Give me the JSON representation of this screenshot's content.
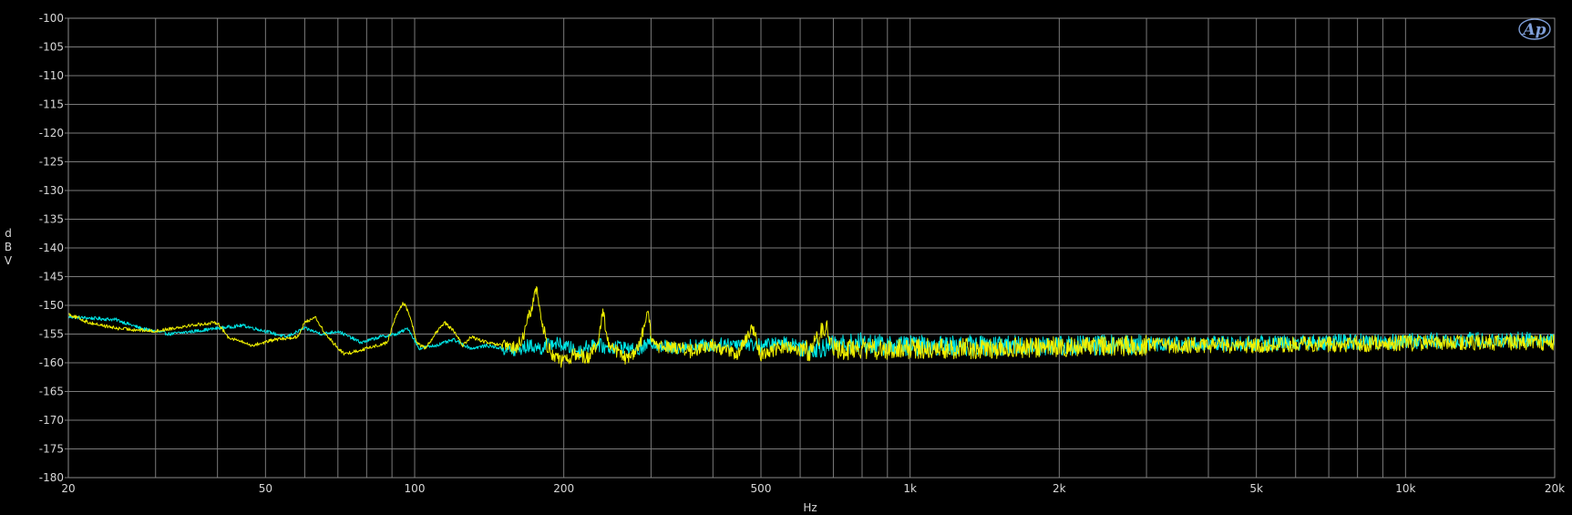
{
  "logo_text": "Ap",
  "chart_data": {
    "type": "line",
    "title": "",
    "xlabel": "Hz",
    "ylabel": "dBV",
    "xscale": "log",
    "xlim": [
      20,
      20000
    ],
    "ylim": [
      -180,
      -100
    ],
    "grid": true,
    "x_major_ticks": [
      20,
      50,
      100,
      200,
      500,
      1000,
      2000,
      5000,
      10000,
      20000
    ],
    "x_tick_labels": [
      "20",
      "50",
      "100",
      "200",
      "500",
      "1k",
      "2k",
      "5k",
      "10k",
      "20k"
    ],
    "x_minor_gridlines": [
      30,
      40,
      60,
      70,
      80,
      90,
      300,
      400,
      600,
      700,
      800,
      900,
      3000,
      4000,
      6000,
      7000,
      8000,
      9000
    ],
    "y_ticks": [
      -100,
      -105,
      -110,
      -115,
      -120,
      -125,
      -130,
      -135,
      -140,
      -145,
      -150,
      -155,
      -160,
      -165,
      -170,
      -175,
      -180
    ],
    "colors": {
      "background": "#000000",
      "grid": "#7a7a7a",
      "text": "#d8d8d8"
    },
    "series": [
      {
        "color": "#00e5e5",
        "x": [
          20,
          25,
          28,
          32,
          36,
          40,
          45,
          50,
          55,
          60,
          65,
          70,
          78,
          85,
          92,
          97,
          102,
          110,
          120,
          130,
          140,
          150,
          160,
          170,
          180,
          190,
          200,
          215,
          230,
          245,
          260,
          280,
          300,
          330,
          360,
          400,
          450,
          500,
          560,
          630,
          700,
          800,
          900,
          1000,
          1200,
          1500,
          2000,
          3000,
          5000,
          7000,
          10000,
          15000,
          20000
        ],
        "y": [
          -152.0,
          -152.5,
          -154.0,
          -155.0,
          -154.5,
          -154.0,
          -153.5,
          -154.5,
          -155.5,
          -154.0,
          -155.0,
          -154.5,
          -156.5,
          -155.5,
          -155.0,
          -154.0,
          -157.5,
          -157.0,
          -156.0,
          -157.5,
          -157.0,
          -157.5,
          -158.0,
          -157.0,
          -157.5,
          -156.5,
          -157.0,
          -158.0,
          -156.5,
          -157.5,
          -157.0,
          -158.0,
          -156.5,
          -157.5,
          -157.0,
          -157.0,
          -156.5,
          -157.0,
          -156.5,
          -157.5,
          -157.0,
          -156.5,
          -157.0,
          -157.0,
          -157.0,
          -157.0,
          -157.0,
          -156.8,
          -156.6,
          -156.4,
          -156.2,
          -156.0,
          -156.0
        ]
      },
      {
        "color": "#f0f000",
        "x": [
          20,
          22,
          25,
          30,
          35,
          40,
          42,
          47,
          52,
          58,
          60,
          63,
          66,
          72,
          80,
          88,
          92,
          95,
          98,
          101,
          105,
          110,
          115,
          120,
          125,
          130,
          140,
          150,
          160,
          165,
          172,
          176,
          180,
          185,
          190,
          200,
          210,
          225,
          235,
          240,
          245,
          255,
          270,
          285,
          295,
          300,
          310,
          330,
          360,
          400,
          450,
          480,
          500,
          560,
          630,
          680,
          700,
          800,
          900,
          1000,
          1200,
          1500,
          2000,
          3000,
          5000,
          7000,
          10000,
          15000,
          20000
        ],
        "y": [
          -151.5,
          -153.0,
          -154.0,
          -154.5,
          -153.5,
          -153.0,
          -155.5,
          -157.0,
          -156.0,
          -155.5,
          -153.0,
          -152.0,
          -155.0,
          -158.5,
          -157.5,
          -156.5,
          -151.5,
          -149.5,
          -152.0,
          -156.5,
          -157.5,
          -155.0,
          -153.0,
          -154.5,
          -157.0,
          -155.5,
          -156.5,
          -157.0,
          -157.5,
          -156.0,
          -150.5,
          -147.0,
          -152.0,
          -157.0,
          -158.5,
          -160.0,
          -158.5,
          -159.0,
          -156.5,
          -151.0,
          -156.0,
          -158.0,
          -159.5,
          -157.0,
          -150.5,
          -155.5,
          -157.5,
          -157.0,
          -158.0,
          -157.0,
          -158.5,
          -154.0,
          -158.5,
          -157.0,
          -158.0,
          -153.0,
          -158.0,
          -157.5,
          -158.0,
          -157.5,
          -157.5,
          -157.5,
          -157.2,
          -157.0,
          -156.9,
          -156.8,
          -156.6,
          -156.5,
          -156.5
        ]
      }
    ]
  }
}
